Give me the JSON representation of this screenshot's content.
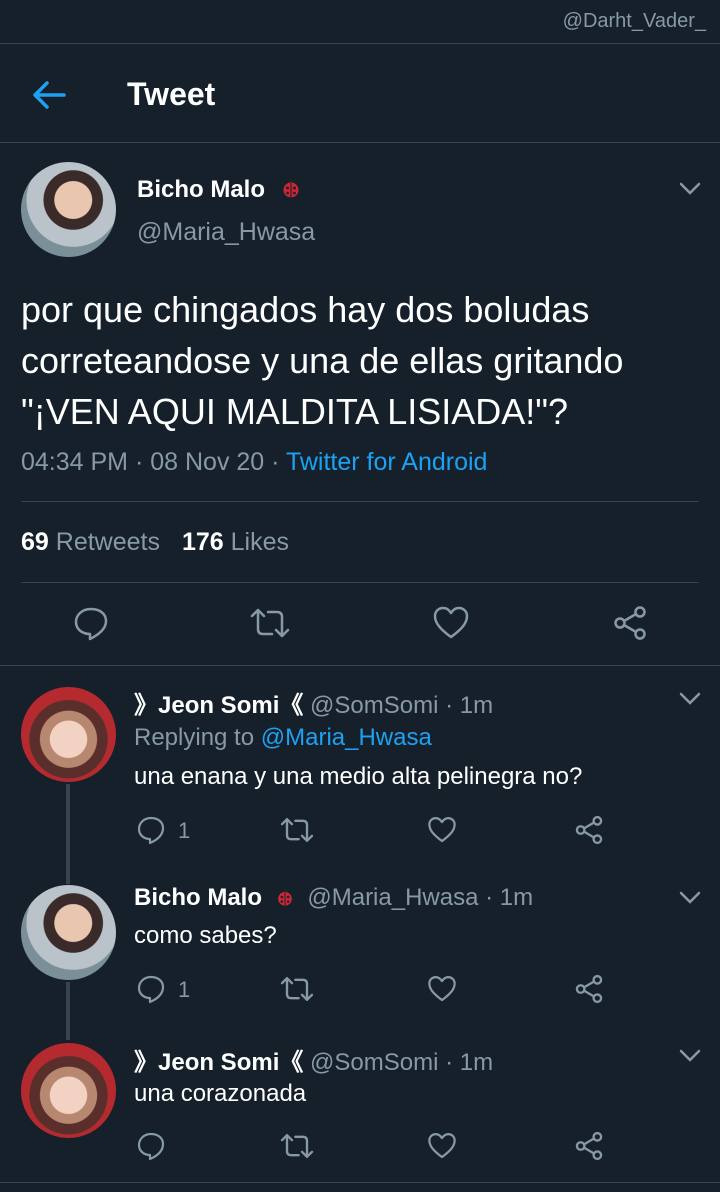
{
  "watermark": "@Darht_Vader_",
  "header": {
    "title": "Tweet"
  },
  "tweet": {
    "name": "Bicho Malo",
    "handle": "@Maria_Hwasa",
    "text": "por que chingados hay dos boludas correteandose y una de ellas gritando \"¡VEN AQUI MALDITA LISIADA!\"?",
    "time": "04:34 PM",
    "sep1": " · ",
    "date": "08 Nov 20",
    "sep2": " · ",
    "source": "Twitter for Android",
    "retweets_count": "69",
    "retweets_label": "Retweets",
    "likes_count": "176",
    "likes_label": "Likes"
  },
  "replies": [
    {
      "name": "》Jeon Somi《",
      "handle": "@SomSomi",
      "time": " · 1m",
      "replying_prefix": "Replying to ",
      "replying_to": "@Maria_Hwasa",
      "text": "una enana y una medio alta pelinegra no?",
      "reply_count": "1"
    },
    {
      "name": "Bicho Malo",
      "handle": "@Maria_Hwasa",
      "time": " · 1m",
      "text": "como sabes?",
      "reply_count": "1"
    },
    {
      "name": "》Jeon Somi《",
      "handle": "@SomSomi",
      "time": " · 1m",
      "text": "una corazonada"
    }
  ],
  "colors": {
    "background": "#15202b",
    "accent": "#1da1f2",
    "muted": "#8899a6",
    "divider": "#38444d",
    "ladybug": "#d0263a"
  }
}
